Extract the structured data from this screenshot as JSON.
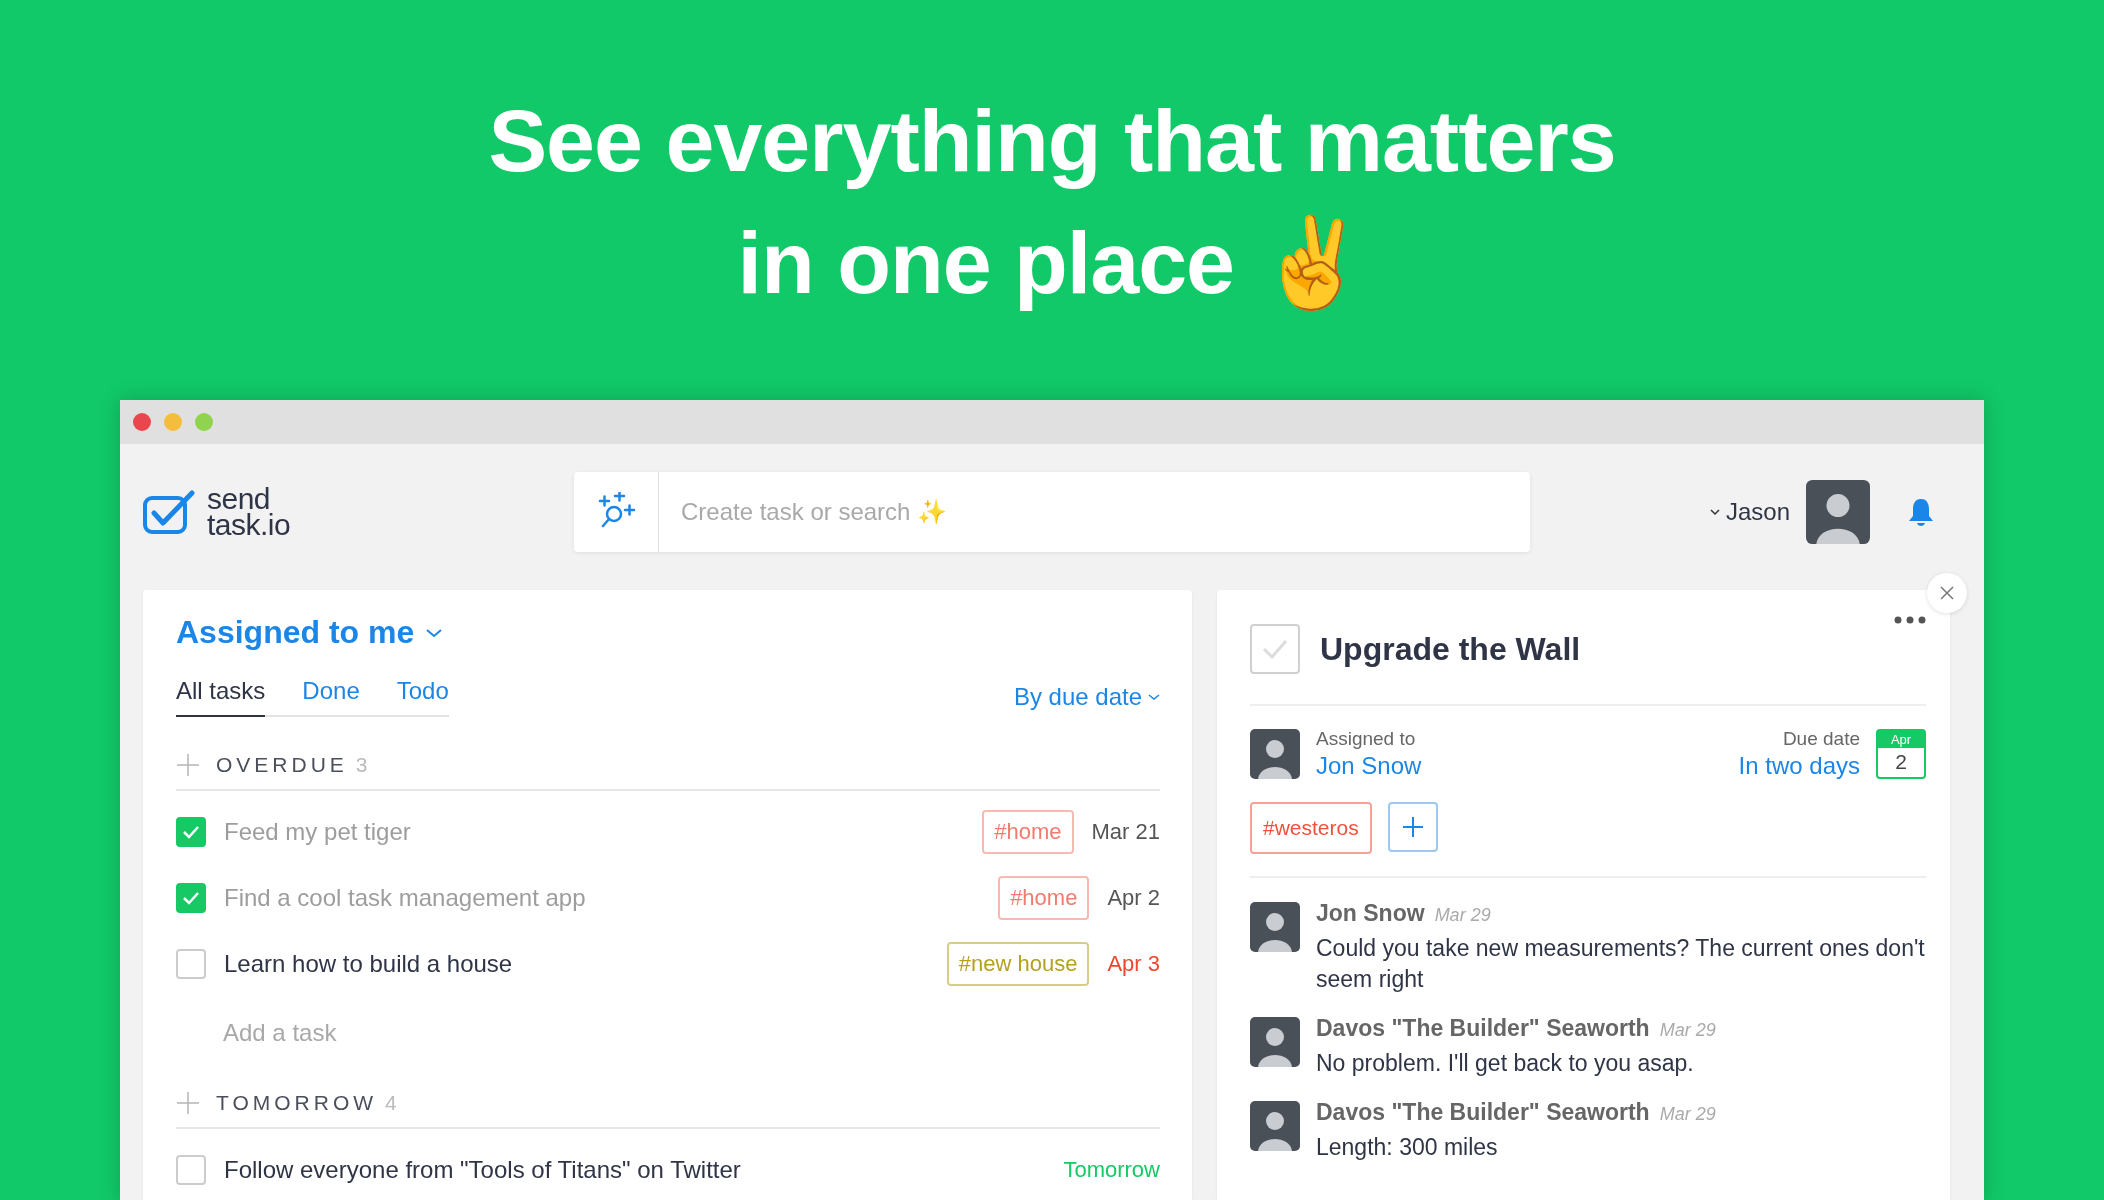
{
  "headline": [
    "See everything that matters",
    "in one place ✌️"
  ],
  "header": {
    "logo": [
      "send",
      "task.io"
    ],
    "search": {
      "placeholder": "Create task or search ✨"
    },
    "user": {
      "name": "Jason"
    }
  },
  "task_list": {
    "title": "Assigned to me",
    "sort": "By due date",
    "tabs": [
      {
        "label": "All tasks",
        "selected": true
      },
      {
        "label": "Done",
        "selected": false
      },
      {
        "label": "Todo",
        "selected": false
      }
    ],
    "sections": [
      {
        "name": "OVERDUE",
        "count": "3",
        "add_task": "Add a task",
        "tasks": [
          {
            "title": "Feed my pet tiger",
            "checked": true,
            "tag": "#home",
            "color": "#f07b6e",
            "due": {
              "text": "Mar 21",
              "color": "#555555"
            }
          },
          {
            "title": "Find a cool task management app",
            "checked": true,
            "tag": "#home",
            "color": "#f07b6e",
            "due": {
              "text": "Apr 2",
              "color": "#555555"
            }
          },
          {
            "title": "Learn how to build a house",
            "checked": false,
            "tag": "#new house",
            "color": "#b3a21e",
            "due": {
              "text": "Apr 3",
              "color": "#f0452f"
            }
          }
        ]
      },
      {
        "name": "TOMORROW",
        "count": "4",
        "tasks": [
          {
            "title": "Follow everyone from \"Tools of Titans\" on Twitter",
            "checked": false,
            "due": {
              "text": "Tomorrow",
              "color": "#17c964"
            }
          }
        ]
      }
    ]
  },
  "detail": {
    "checked": false,
    "title": "Upgrade the Wall",
    "assignee_label": "Assigned to",
    "assignee": "Jon Snow",
    "due_label": "Due date",
    "due": "In two days",
    "calendar": {
      "month": "Apr",
      "day": "2"
    },
    "tags": [
      {
        "label": "#westeros",
        "color": "#f0503c"
      }
    ],
    "comments": [
      {
        "author": "Jon Snow",
        "date": "Mar 29",
        "text": "Could you take new measurements? The current ones don't seem right"
      },
      {
        "author": "Davos \"The Builder\" Seaworth",
        "date": "Mar 29",
        "text": "No problem. I'll get back to you asap."
      },
      {
        "author": "Davos \"The Builder\" Seaworth",
        "date": "Mar 29",
        "text": "Length: 300 miles"
      }
    ]
  }
}
